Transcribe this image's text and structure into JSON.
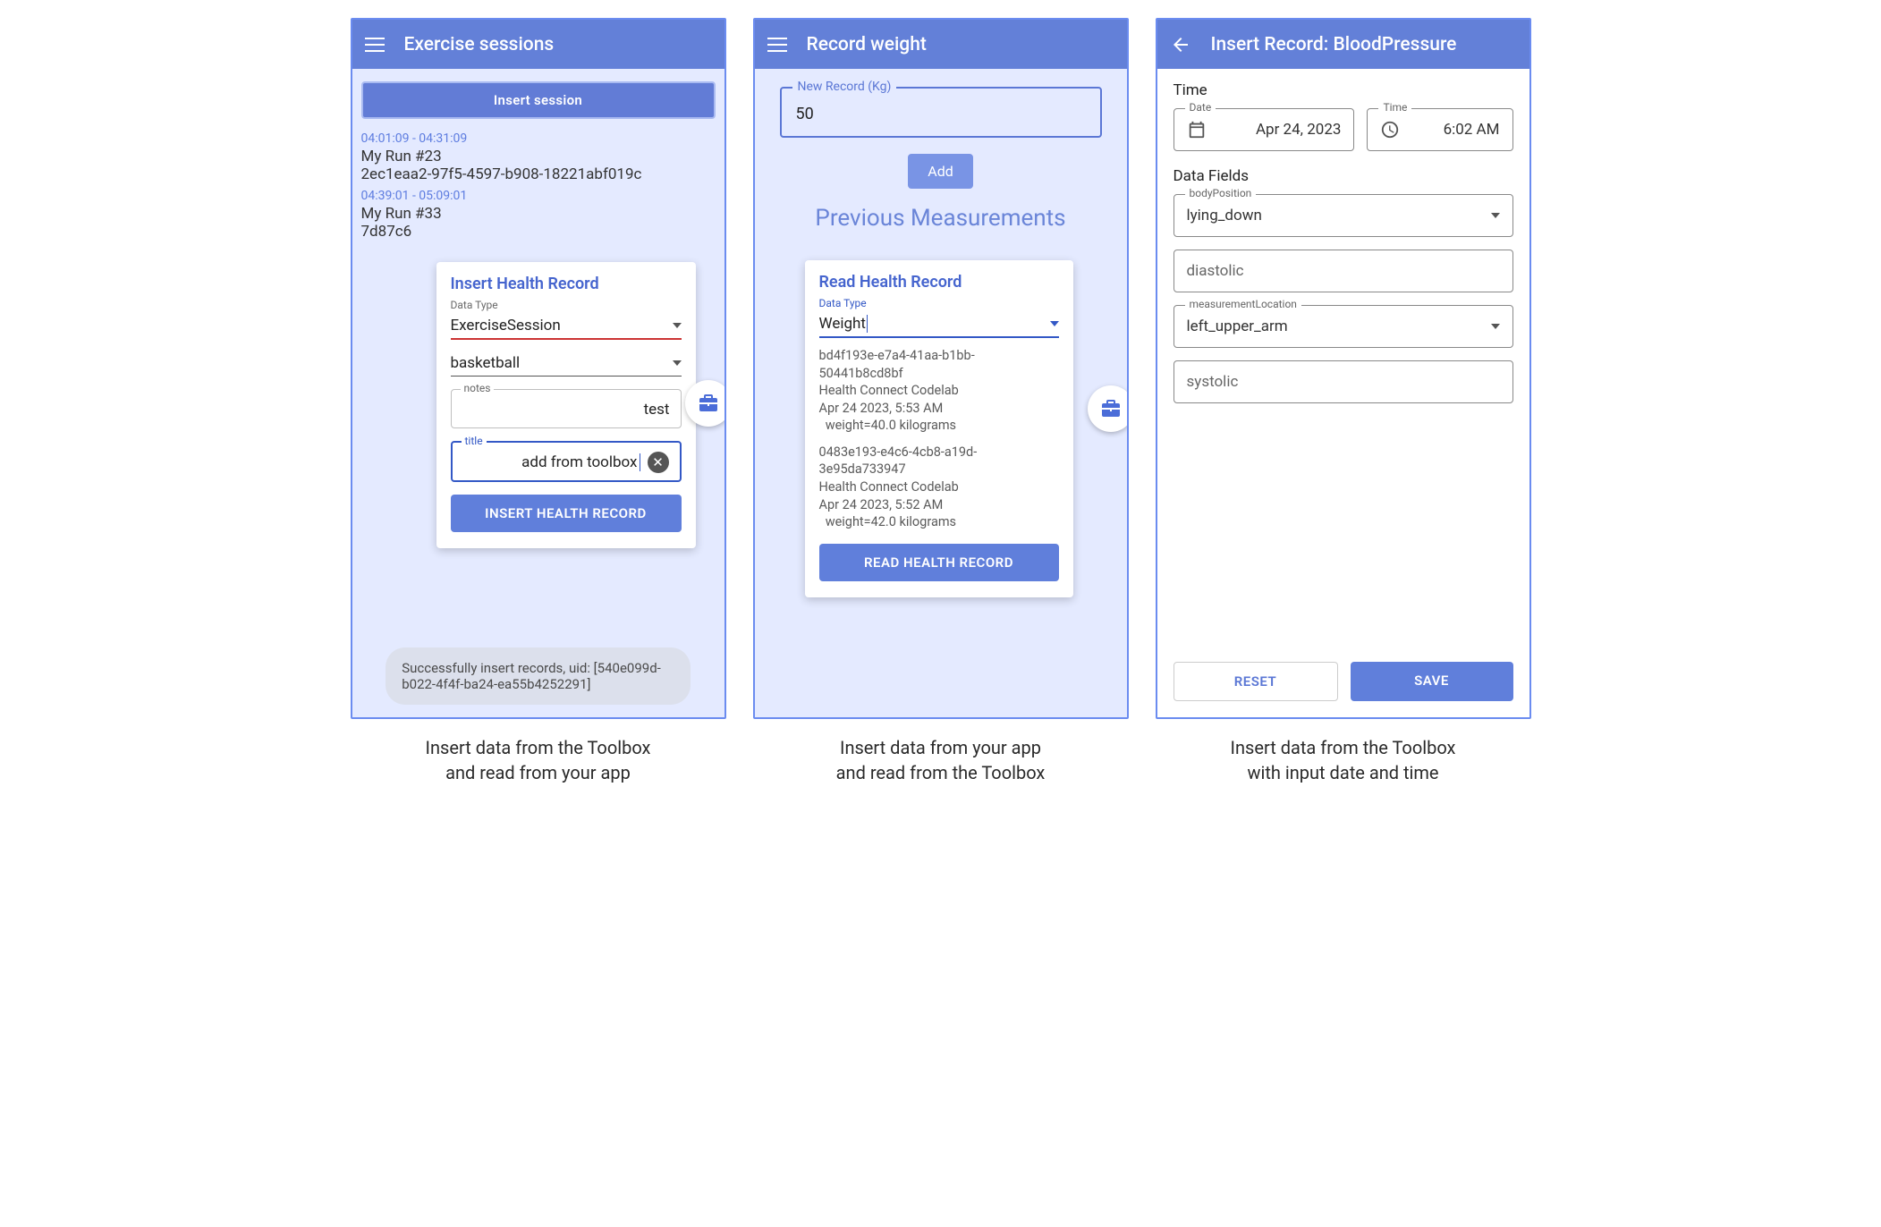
{
  "col1": {
    "appbar_title": "Exercise sessions",
    "insert_session": "Insert session",
    "sessions": [
      {
        "time": "04:01:09 - 04:31:09",
        "title": "My Run #23",
        "id": "2ec1eaa2-97f5-4597-b908-18221abf019c"
      },
      {
        "time": "04:39:01 - 05:09:01",
        "title": "My Run #33",
        "id": "7d87c6"
      }
    ],
    "overlay": {
      "title": "Insert Health Record",
      "data_type_label": "Data Type",
      "data_type_value": "ExerciseSession",
      "exercise_type": "basketball",
      "notes_label": "notes",
      "notes_value": "test",
      "title_label": "title",
      "title_value": "add from toolbox",
      "button": "INSERT HEALTH RECORD"
    },
    "toast": "Successfully insert records, uid: [540e099d-b022-4f4f-ba24-ea55b4252291]",
    "caption": "Insert data from the Toolbox\nand read from your app"
  },
  "col2": {
    "appbar_title": "Record weight",
    "new_record_label": "New Record (Kg)",
    "new_record_value": "50",
    "add": "Add",
    "prev_meas": "Previous Measurements",
    "overlay": {
      "title": "Read Health Record",
      "data_type_label": "Data Type",
      "data_type_value": "Weight",
      "records": [
        {
          "uid": "bd4f193e-e7a4-41aa-b1bb-50441b8cd8bf",
          "app": "Health Connect Codelab",
          "ts": "Apr 24 2023, 5:53 AM",
          "val": "  weight=40.0 kilograms"
        },
        {
          "uid": "0483e193-e4c6-4cb8-a19d-3e95da733947",
          "app": "Health Connect Codelab",
          "ts": "Apr 24 2023, 5:52 AM",
          "val": "  weight=42.0 kilograms"
        }
      ],
      "button": "READ HEALTH RECORD"
    },
    "caption": "Insert data from your app\nand read from the Toolbox"
  },
  "col3": {
    "appbar_title": "Insert Record: BloodPressure",
    "time_section": "Time",
    "date_label": "Date",
    "date_value": "Apr 24, 2023",
    "time_label": "Time",
    "time_value": "6:02 AM",
    "fields_section": "Data Fields",
    "body_position_label": "bodyPosition",
    "body_position_value": "lying_down",
    "diastolic": "diastolic",
    "measurement_location_label": "measurementLocation",
    "measurement_location_value": "left_upper_arm",
    "systolic": "systolic",
    "reset": "RESET",
    "save": "SAVE",
    "caption": "Insert data from the Toolbox\nwith input date and time"
  }
}
